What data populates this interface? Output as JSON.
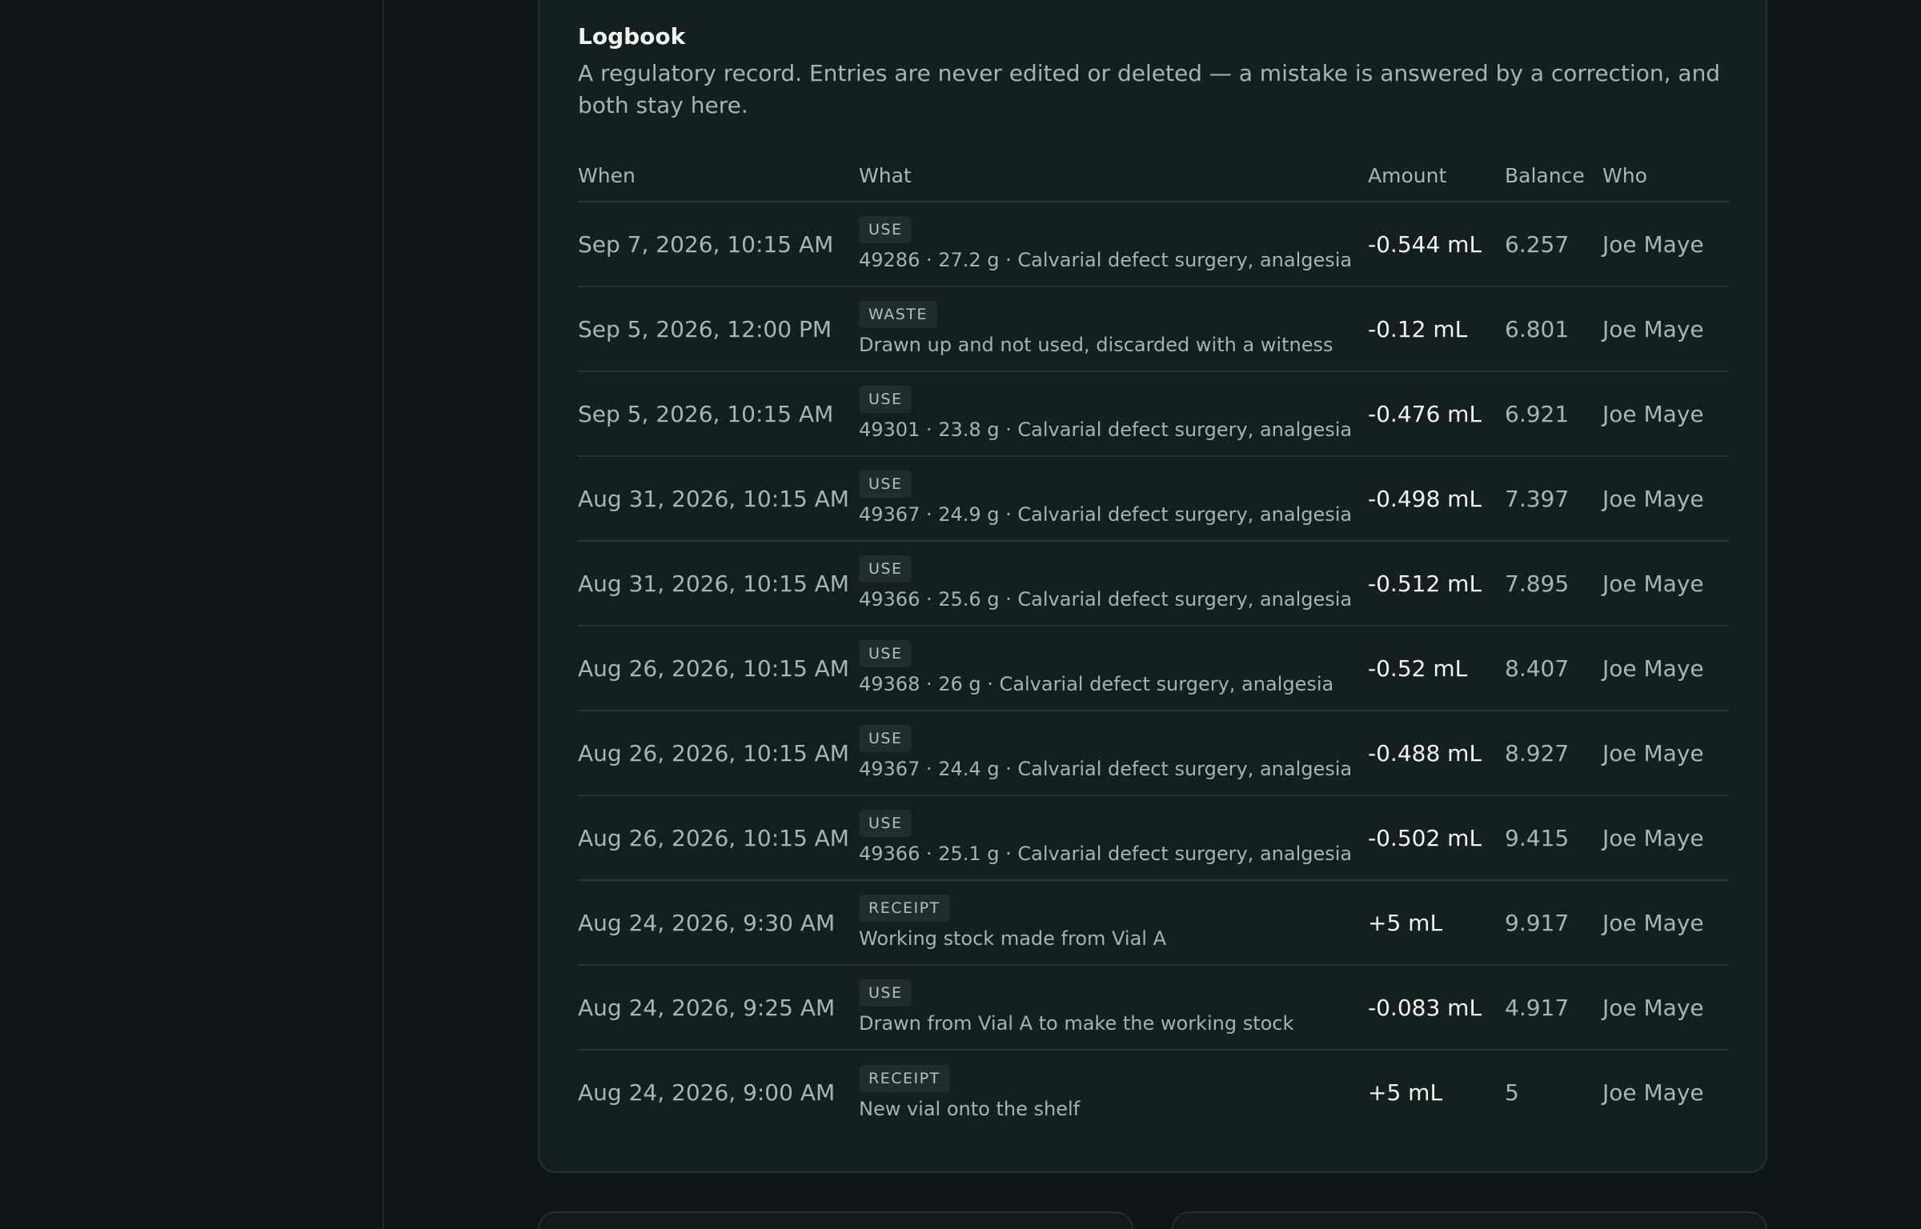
{
  "logbook": {
    "title": "Logbook",
    "description": "A regulatory record. Entries are never edited or deleted — a mistake is answered by a correction, and both stay here.",
    "columns": {
      "when": "When",
      "what": "What",
      "amount": "Amount",
      "balance": "Balance",
      "who": "Who"
    },
    "entries": [
      {
        "when": "Sep 7, 2026, 10:15 AM",
        "type": "USE",
        "detail": "49286 · 27.2 g · Calvarial defect surgery, analgesia",
        "amount": "-0.544 mL",
        "balance": "6.257",
        "who": "Joe Maye"
      },
      {
        "when": "Sep 5, 2026, 12:00 PM",
        "type": "WASTE",
        "detail": "Drawn up and not used, discarded with a witness",
        "amount": "-0.12 mL",
        "balance": "6.801",
        "who": "Joe Maye"
      },
      {
        "when": "Sep 5, 2026, 10:15 AM",
        "type": "USE",
        "detail": "49301 · 23.8 g · Calvarial defect surgery, analgesia",
        "amount": "-0.476 mL",
        "balance": "6.921",
        "who": "Joe Maye"
      },
      {
        "when": "Aug 31, 2026, 10:15 AM",
        "type": "USE",
        "detail": "49367 · 24.9 g · Calvarial defect surgery, analgesia",
        "amount": "-0.498 mL",
        "balance": "7.397",
        "who": "Joe Maye"
      },
      {
        "when": "Aug 31, 2026, 10:15 AM",
        "type": "USE",
        "detail": "49366 · 25.6 g · Calvarial defect surgery, analgesia",
        "amount": "-0.512 mL",
        "balance": "7.895",
        "who": "Joe Maye"
      },
      {
        "when": "Aug 26, 2026, 10:15 AM",
        "type": "USE",
        "detail": "49368 · 26 g · Calvarial defect surgery, analgesia",
        "amount": "-0.52 mL",
        "balance": "8.407",
        "who": "Joe Maye"
      },
      {
        "when": "Aug 26, 2026, 10:15 AM",
        "type": "USE",
        "detail": "49367 · 24.4 g · Calvarial defect surgery, analgesia",
        "amount": "-0.488 mL",
        "balance": "8.927",
        "who": "Joe Maye"
      },
      {
        "when": "Aug 26, 2026, 10:15 AM",
        "type": "USE",
        "detail": "49366 · 25.1 g · Calvarial defect surgery, analgesia",
        "amount": "-0.502 mL",
        "balance": "9.415",
        "who": "Joe Maye"
      },
      {
        "when": "Aug 24, 2026, 9:30 AM",
        "type": "RECEIPT",
        "detail": "Working stock made from Vial A",
        "amount": "+5 mL",
        "balance": "9.917",
        "who": "Joe Maye"
      },
      {
        "when": "Aug 24, 2026, 9:25 AM",
        "type": "USE",
        "detail": "Drawn from Vial A to make the working stock",
        "amount": "-0.083 mL",
        "balance": "4.917",
        "who": "Joe Maye"
      },
      {
        "when": "Aug 24, 2026, 9:00 AM",
        "type": "RECEIPT",
        "detail": "New vial onto the shelf",
        "amount": "+5 mL",
        "balance": "5",
        "who": "Joe Maye"
      }
    ]
  }
}
